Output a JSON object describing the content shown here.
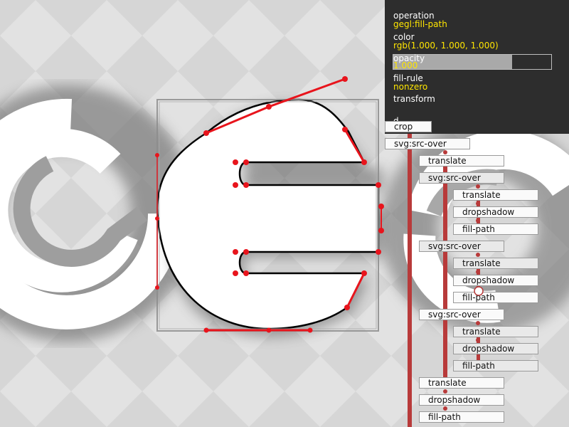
{
  "properties": {
    "operation_label": "operation",
    "operation_value": "gegl:fill-path",
    "color_label": "color",
    "color_value": "rgb(1.000, 1.000, 1.000)",
    "opacity_label": "opacity",
    "opacity_value": "1.000",
    "opacity_level": 0.75,
    "fill_rule_label": "fill-rule",
    "fill_rule_value": "nonzero",
    "transform_label": "transform",
    "d_label": "d"
  },
  "graph_nodes": [
    {
      "label": "crop"
    },
    {
      "label": "svg:src-over"
    },
    {
      "label": "translate"
    },
    {
      "label": "svg:src-over"
    },
    {
      "label": "translate"
    },
    {
      "label": "dropshadow"
    },
    {
      "label": "fill-path"
    },
    {
      "label": "svg:src-over"
    },
    {
      "label": "translate"
    },
    {
      "label": "dropshadow"
    },
    {
      "label": "fill-path"
    },
    {
      "label": "svg:src-over"
    },
    {
      "label": "translate"
    },
    {
      "label": "dropshadow"
    },
    {
      "label": "fill-path"
    },
    {
      "label": "translate"
    },
    {
      "label": "dropshadow"
    },
    {
      "label": "fill-path"
    }
  ],
  "colors": {
    "accent": "#e8141c",
    "graph_link": "#b83a3a",
    "panel_bg": "#2d2d2d",
    "value_text": "#ffe600"
  }
}
